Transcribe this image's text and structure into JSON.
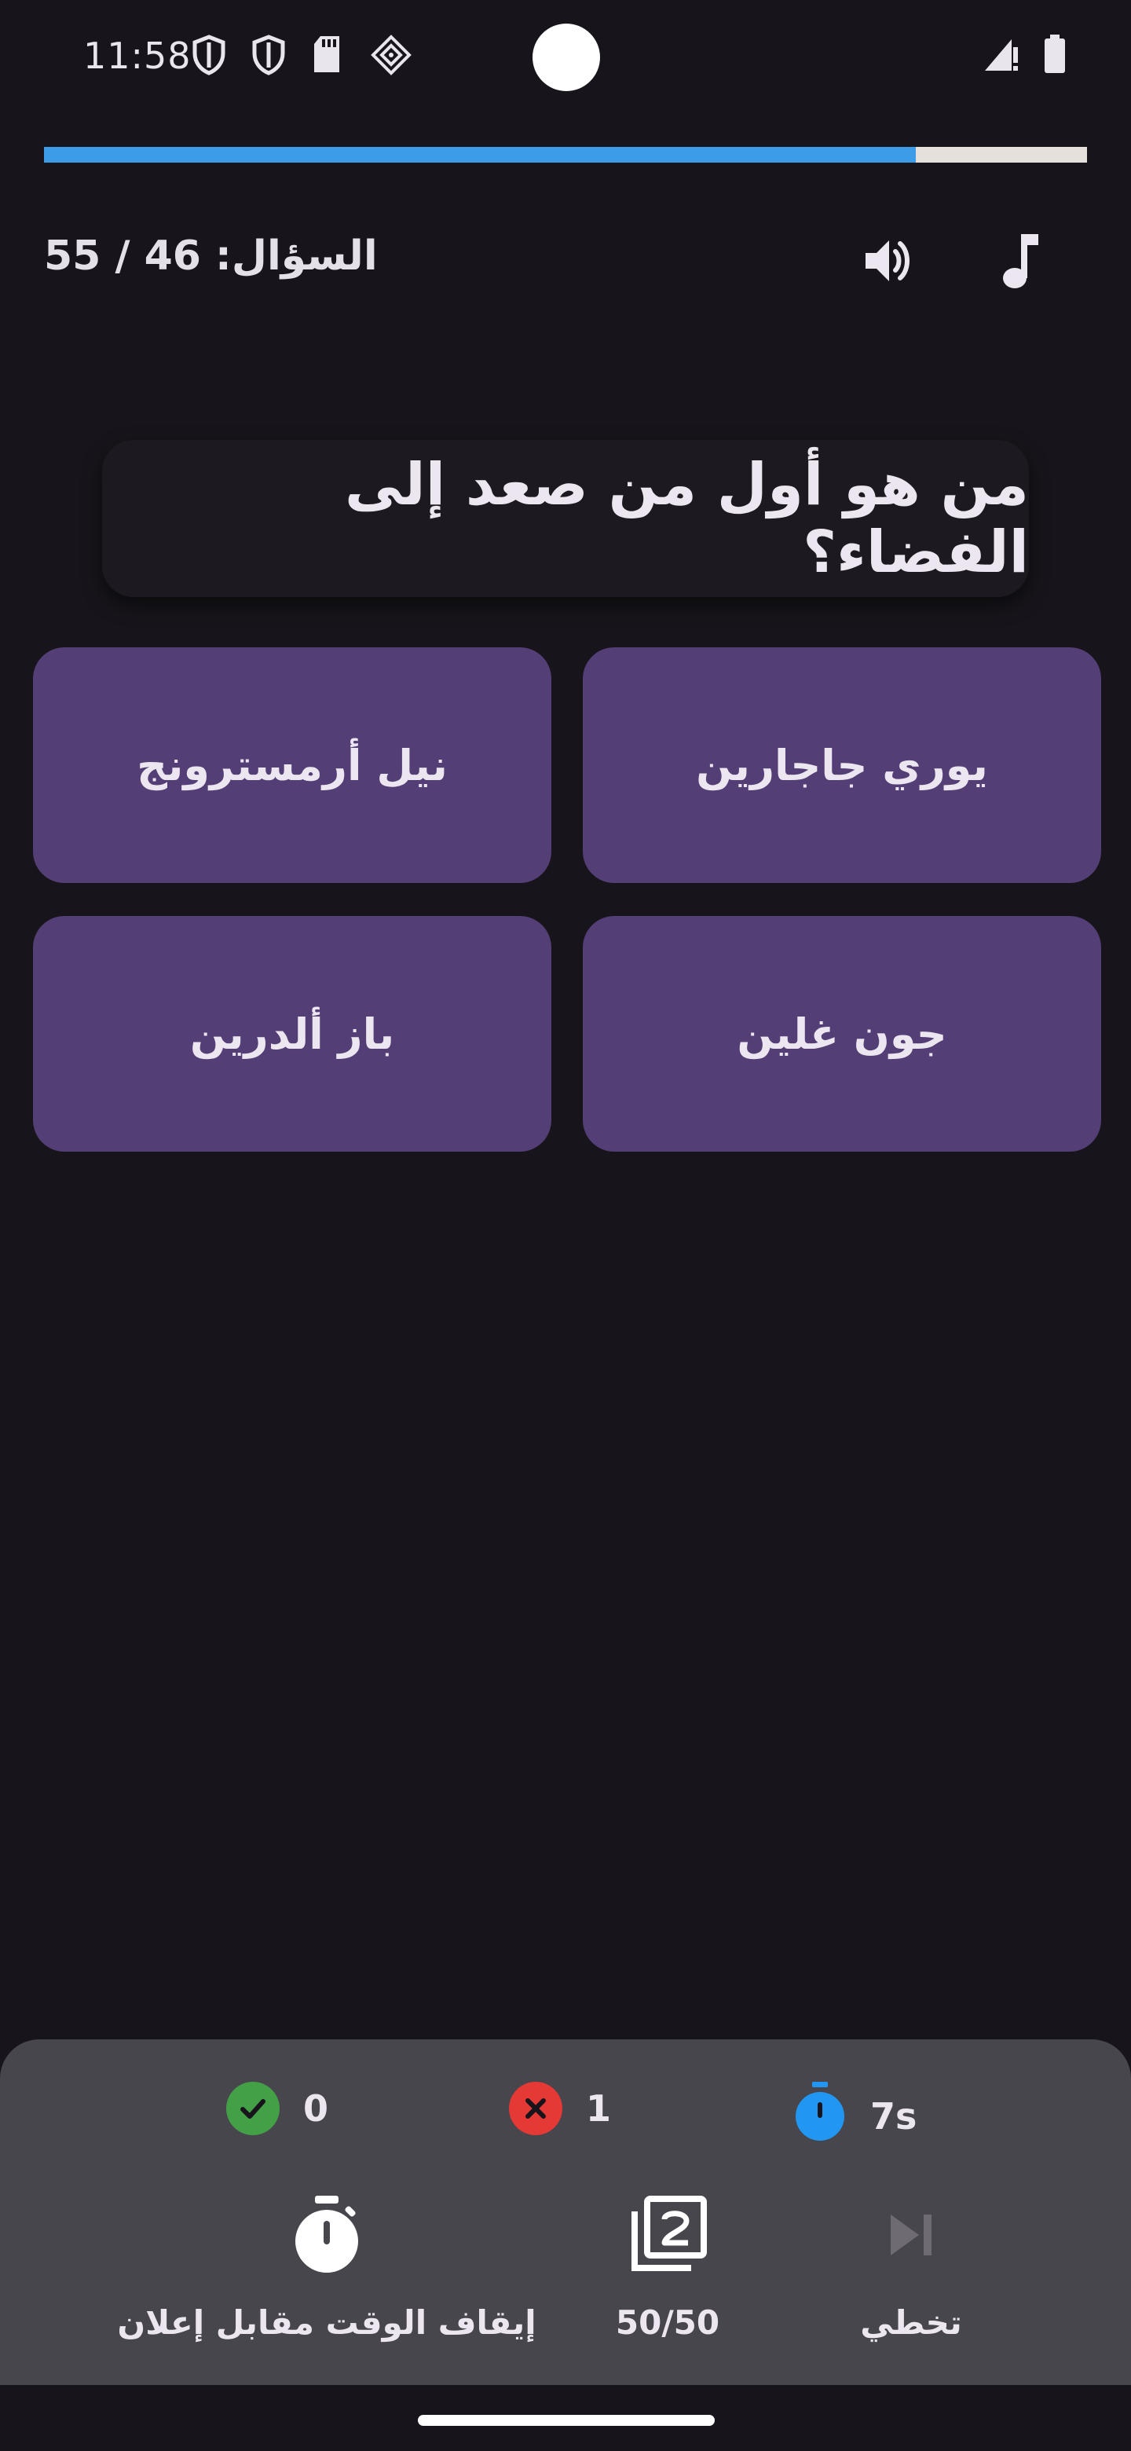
{
  "status_bar": {
    "time": "11:58",
    "left_icons": [
      "shield-icon",
      "shield-icon",
      "sd-card-icon",
      "vpn-key-icon"
    ],
    "right_icons": [
      "signal-icon",
      "battery-icon"
    ]
  },
  "progress": {
    "value": 0.836,
    "fill_color": "#3d9ce8",
    "track_color": "#e6e0dc"
  },
  "header": {
    "counter": "السؤال: 46 / 55",
    "volume_icon": "volume-icon",
    "music_icon": "music-note-icon"
  },
  "question": {
    "text": "من هو أول من صعد إلى الفضاء؟"
  },
  "answers": [
    {
      "label": "يوري جاجارين"
    },
    {
      "label": "نيل أرمسترونج"
    },
    {
      "label": "جون غلين"
    },
    {
      "label": "باز ألدرين"
    }
  ],
  "stats": {
    "correct": "0",
    "wrong": "1",
    "time": "7s",
    "colors": {
      "correct": "#43a047",
      "wrong": "#e53935",
      "time": "#2196f3"
    }
  },
  "actions": {
    "pause_time_label": "إيقاف الوقت مقابل إعلان",
    "fifty_label": "50/50",
    "skip_label": "تخطي"
  },
  "colors": {
    "background": "#17151b",
    "answer_bg": "#533e75",
    "panel_bg": "#48464d"
  }
}
